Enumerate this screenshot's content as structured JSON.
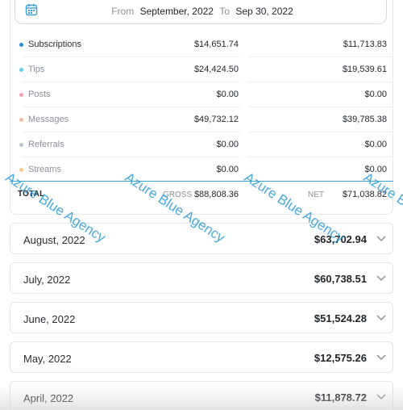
{
  "date_range": {
    "from_label": "From",
    "from_value": "September, 2022",
    "to_label": "To",
    "to_value": "Sep 30, 2022"
  },
  "breakdown": {
    "rows": [
      {
        "label": "Subscriptions",
        "gross": "$14,651.74",
        "net": "$11,713.83",
        "dot_color": "#2b8fd6",
        "dim": false
      },
      {
        "label": "Tips",
        "gross": "$24,424.50",
        "net": "$19,539.61",
        "dot_color": "#5fd0e6",
        "dim": true
      },
      {
        "label": "Posts",
        "gross": "$0.00",
        "net": "$0.00",
        "dot_color": "#f2a0ad",
        "dim": true
      },
      {
        "label": "Messages",
        "gross": "$49,732.12",
        "net": "$39,785.38",
        "dot_color": "#f5b7a6",
        "dim": true
      },
      {
        "label": "Referrals",
        "gross": "$0.00",
        "net": "$0.00",
        "dot_color": "#b9c2cc",
        "dim": true
      },
      {
        "label": "Streams",
        "gross": "$0.00",
        "net": "$0.00",
        "dot_color": "#f7c48a",
        "dim": true
      }
    ],
    "total": {
      "label": "TOTAL",
      "gross_label": "GROSS",
      "gross_value": "$88,808.36",
      "net_label": "NET",
      "net_value": "$71,038.82"
    }
  },
  "watermark": {
    "text": "Azure Blue Agency"
  },
  "months": [
    {
      "label": "August, 2022",
      "amount": "$63,702.94"
    },
    {
      "label": "July, 2022",
      "amount": "$60,738.51"
    },
    {
      "label": "June, 2022",
      "amount": "$51,524.28"
    },
    {
      "label": "May, 2022",
      "amount": "$12,575.26"
    },
    {
      "label": "April, 2022",
      "amount": "$11,878.72"
    }
  ],
  "colors": {
    "accent": "#2b8fd6",
    "watermark": "#2a9ad8"
  }
}
